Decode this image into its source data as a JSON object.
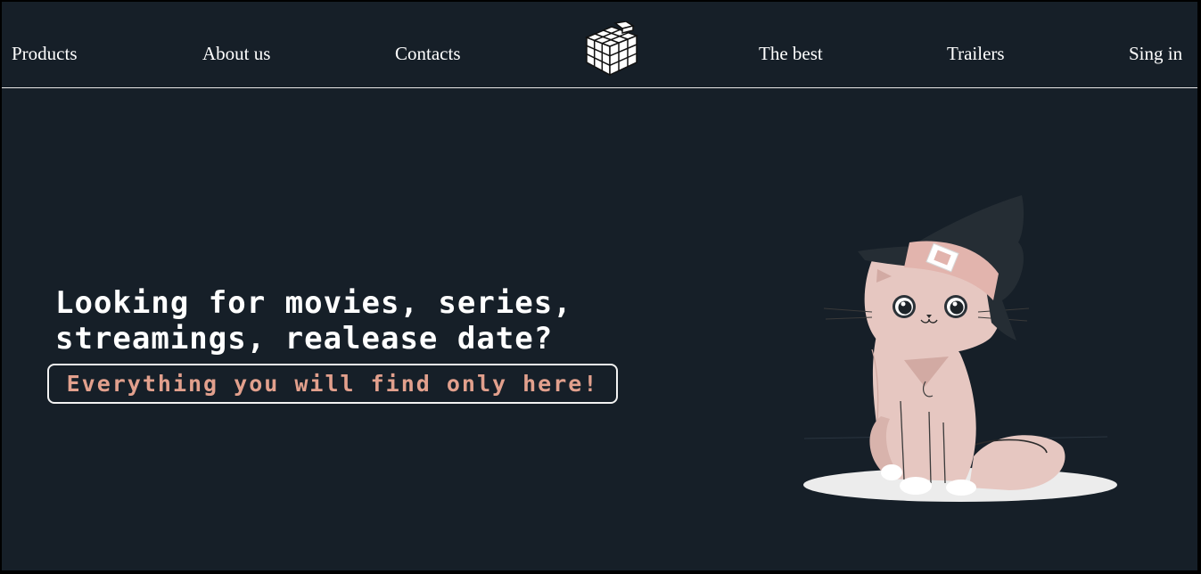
{
  "nav": {
    "left_items": [
      {
        "label": "Products"
      },
      {
        "label": "About us"
      },
      {
        "label": "Contacts"
      }
    ],
    "right_items": [
      {
        "label": "The best"
      },
      {
        "label": "Trailers"
      },
      {
        "label": "Sing in"
      }
    ],
    "logo_icon": "rubiks-cube-icon"
  },
  "hero": {
    "title_line1": "Looking for movies, series,",
    "title_line2": "streamings, realease date?",
    "tagline": "Everything you will find only here!",
    "illustration": "witch-cat-illustration"
  },
  "colors": {
    "background": "#161f28",
    "text": "#ffffff",
    "accent": "#e2a08d",
    "cat_body": "#e6c7c1",
    "hat": "#252d34"
  }
}
